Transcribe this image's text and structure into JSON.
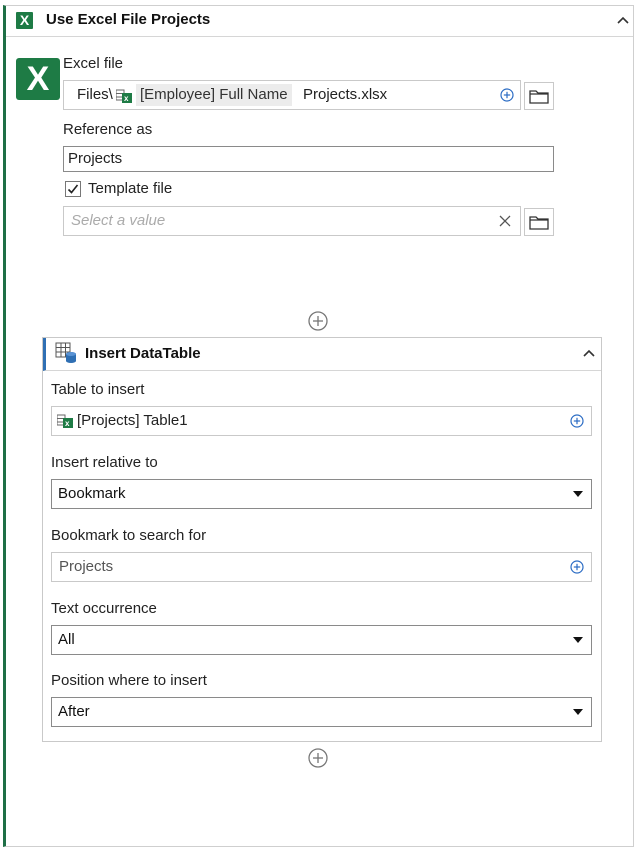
{
  "outer": {
    "title": "Use Excel File Projects",
    "badge": "X",
    "excel_file_label": "Excel file",
    "excel_file_prefix": "Files\\",
    "excel_file_chip": "[Employee] Full Name",
    "excel_file_suffix": "Projects.xlsx",
    "reference_label": "Reference as",
    "reference_value": "Projects",
    "template_label": "Template file",
    "template_checked": true,
    "template_placeholder": "Select a value"
  },
  "inner": {
    "title": "Insert DataTable",
    "table_label": "Table to insert",
    "table_value": "[Projects] Table1",
    "relative_label": "Insert relative to",
    "relative_value": "Bookmark",
    "bookmark_label": "Bookmark to search for",
    "bookmark_value": "Projects",
    "occurrence_label": "Text occurrence",
    "occurrence_value": "All",
    "position_label": "Position where to insert",
    "position_value": "After"
  },
  "colors": {
    "excel_green": "#1e7b45",
    "accent_blue": "#2f6fb3",
    "plus_blue": "#2b6cc4"
  }
}
